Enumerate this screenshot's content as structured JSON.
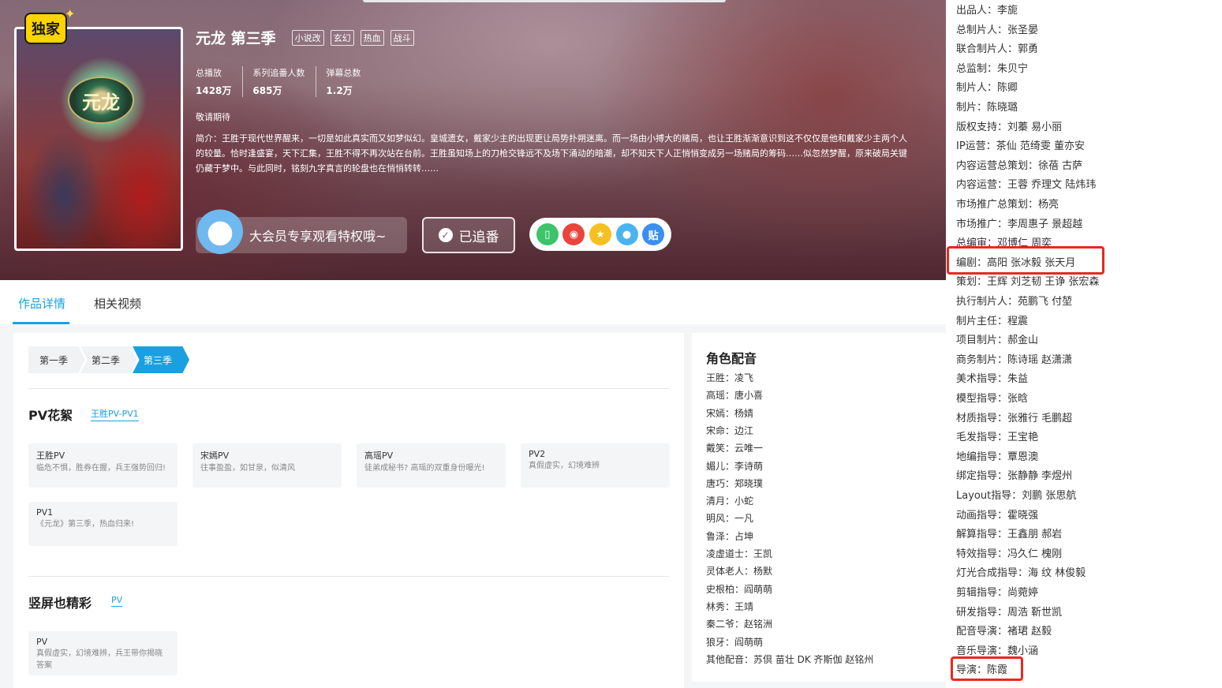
{
  "hero": {
    "exclusive_badge": "独家",
    "poster_logo_text": "元龙",
    "title": "元龙 第三季",
    "tags": [
      "小说改",
      "玄幻",
      "热血",
      "战斗"
    ],
    "stats": [
      {
        "label": "总播放",
        "value": "1428万"
      },
      {
        "label": "系列追番人数",
        "value": "685万"
      },
      {
        "label": "弹幕总数",
        "value": "1.2万"
      }
    ],
    "status": "敬请期待",
    "synopsis": "简介：王胜于现代世界醒来，一切是如此真实而又如梦似幻。皇城遗女，戴家少主的出现更让局势扑朔迷离。而一场由小搏大的赌局，也让王胜渐渐意识到这不仅仅是他和戴家少主两个人的较量。恰时逢盛宴，天下汇集，王胜不得不再次站在台前。王胜虽知场上的刀枪交锋远不及场下涌动的暗潮，却不知天下人正悄悄变成另一场赌局的筹码……似忽然梦醒，原来破局关键仍藏于梦中。与此同时，铭刻九字真言的轮盘也在悄悄转转……",
    "vip_text": "大会员专享观看特权哦~",
    "follow_label": "已追番",
    "share_icons": [
      {
        "name": "phone-icon",
        "glyph": "▯",
        "color": "#3cc36b"
      },
      {
        "name": "weibo-icon",
        "glyph": "◉",
        "color": "#e8453c"
      },
      {
        "name": "qzone-icon",
        "glyph": "★",
        "color": "#f5c022"
      },
      {
        "name": "qq-icon",
        "glyph": "●",
        "color": "#4ab4f0"
      },
      {
        "name": "tieba-icon",
        "glyph": "贴",
        "color": "#3a8ff0"
      }
    ]
  },
  "tabs": [
    {
      "label": "作品详情",
      "active": true
    },
    {
      "label": "相关视频",
      "active": false
    }
  ],
  "seasons": [
    {
      "label": "第一季",
      "active": false
    },
    {
      "label": "第二季",
      "active": false
    },
    {
      "label": "第三季",
      "active": true
    }
  ],
  "pv_section": {
    "title": "PV花絮",
    "link": "王胜PV-PV1",
    "cards": [
      {
        "title": "王胜PV",
        "desc": "临危不惧，胜券在握，兵王强势回归!"
      },
      {
        "title": "宋嫣PV",
        "desc": "往事盈盈，如甘泉，似清风"
      },
      {
        "title": "高瑶PV",
        "desc": "徒弟成秘书? 高瑶的双重身份曝光!"
      },
      {
        "title": "PV2",
        "desc": "真假虚实，幻境难辨"
      },
      {
        "title": "PV1",
        "desc": "《元龙》第三季，热血归来!"
      }
    ]
  },
  "vertical_section": {
    "title": "竖屏也精彩",
    "link": "PV",
    "cards": [
      {
        "title": "PV",
        "desc": "真假虚实，幻境难辨，兵王带你揭晓答案"
      }
    ]
  },
  "cast": {
    "title": "角色配音",
    "lines": [
      "王胜：凌飞",
      "高瑶：唐小喜",
      "宋嫣：杨婧",
      "宋命：边江",
      "戴笑：云唯一",
      "媚儿：李诗萌",
      "唐巧：郑晓璞",
      "清月：小蛇",
      "明风：一凡",
      "鲁泽：占坤",
      "凌虚道士：王凯",
      "灵体老人：杨默",
      "史根柏：阎萌萌",
      "林秀：王靖",
      "秦二爷：赵铭洲",
      "狼牙：阎萌萌",
      "其他配音：苏倶 苗壮 DK 齐斯伽 赵铭州"
    ]
  },
  "credits": {
    "lines": [
      "出品人：李旎",
      "总制片人：张圣晏",
      "联合制片人：郭勇",
      "总监制：朱贝宁",
      "制片人：陈卿",
      "制片：陈晓璐",
      "版权支持：刘蓁 易小丽",
      "IP运营：茶仙 范绮雯 董亦安",
      "内容运营总策划：徐蓓 古萨",
      "内容运营：王蓉 乔理文 陆炜玮",
      "市场推广总策划：杨亮",
      "市场推广：李周惠子 景超越",
      "总编审：邓博仁 周奕",
      "编剧：高阳 张冰毅 张天月",
      "策划：王辉 刘芝韧 王诤 张宏森",
      "执行制片人：苑鹏飞 付堃",
      "制片主任：程震",
      "项目制片：郝金山",
      "商务制片：陈诗瑶 赵潇潇",
      "美术指导：朱益",
      "模型指导：张晗",
      "材质指导：张雅行 毛鹏超",
      "毛发指导：王宝艳",
      "地编指导：覃恩澳",
      "绑定指导：张静静 李煜州",
      "Layout指导：刘鹏 张思航",
      "动画指导：霍晓强",
      "解算指导：王鑫朋 郝岩",
      "特效指导：冯久仁 槐刚",
      "灯光合成指导：海 纹 林俊毅",
      "剪辑指导：尚菀婷",
      "研发指导：周浩 靳世凯",
      "配音导演：褚珺 赵毅",
      "音乐导演：魏小涵",
      "导演：陈霞"
    ]
  }
}
